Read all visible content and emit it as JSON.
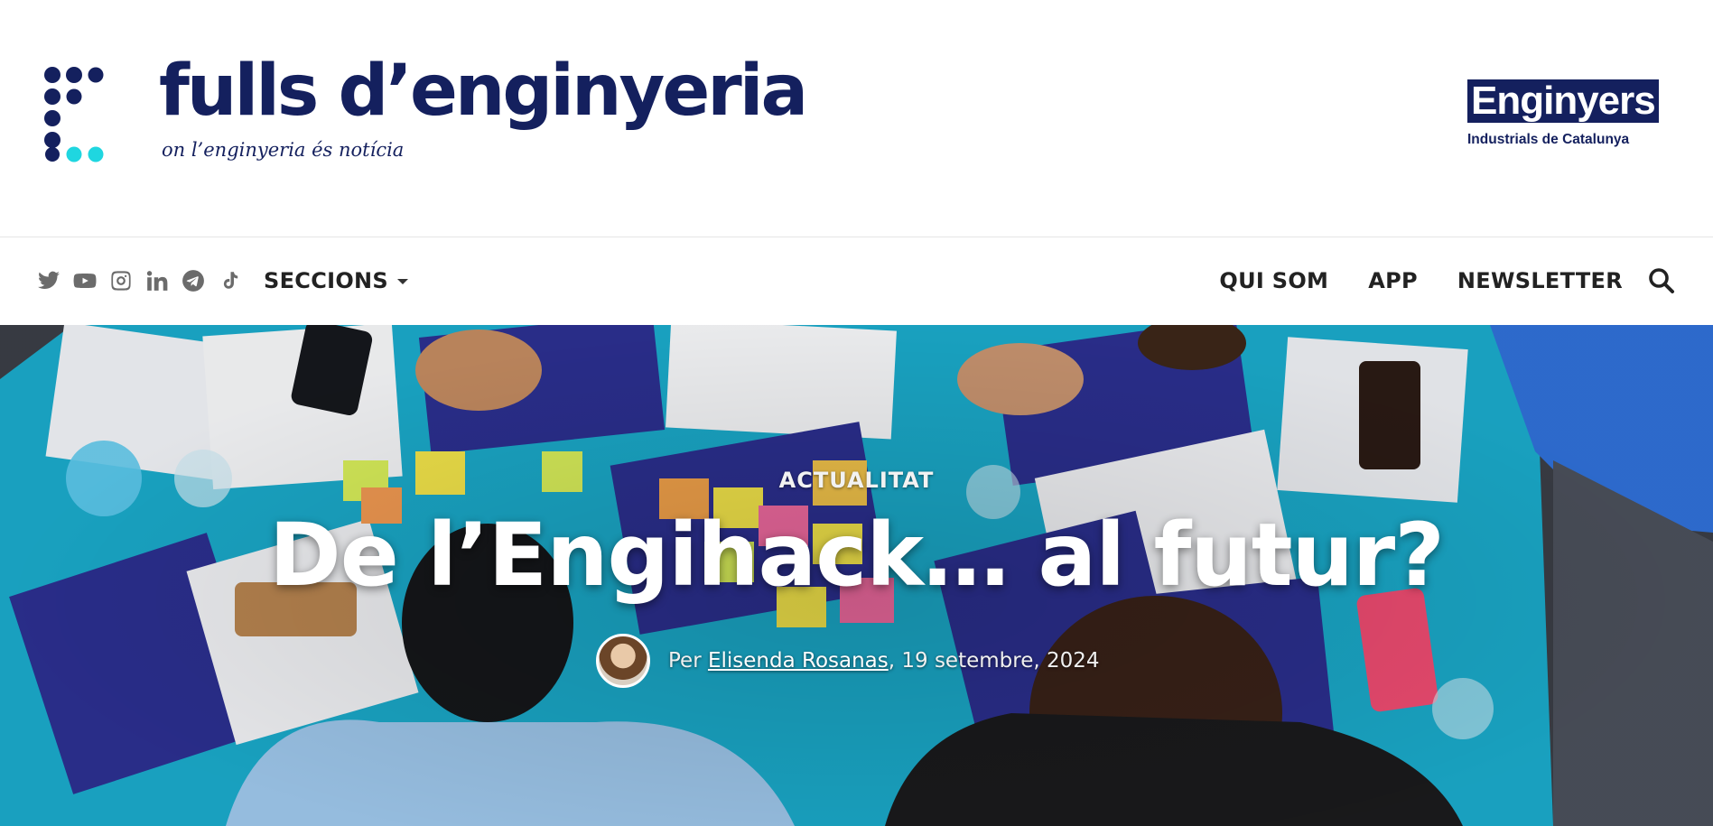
{
  "header": {
    "brand_name": "fulls d’enginyeria",
    "tagline": "on l’enginyeria és notícia",
    "partner_name": "Enginyers",
    "partner_subtitle": "Industrials de Catalunya"
  },
  "nav": {
    "social_icons": [
      "twitter-icon",
      "youtube-icon",
      "instagram-icon",
      "linkedin-icon",
      "telegram-icon",
      "tiktok-icon"
    ],
    "menu_label": "SECCIONS",
    "links": {
      "about": "QUI SOM",
      "app": "APP",
      "newsletter": "NEWSLETTER"
    },
    "search_icon": "search-icon"
  },
  "article": {
    "category": "ACTUALITAT",
    "title": "De l’Engihack… al futur?",
    "byline_prefix": "Per ",
    "author": "Elisenda Rosanas",
    "date": ", 19 setembre, 2024"
  },
  "colors": {
    "brand_navy": "#14205e",
    "brand_cyan": "#1fd6e0",
    "nav_text": "#222222",
    "social_icon": "#6b6b6b"
  }
}
